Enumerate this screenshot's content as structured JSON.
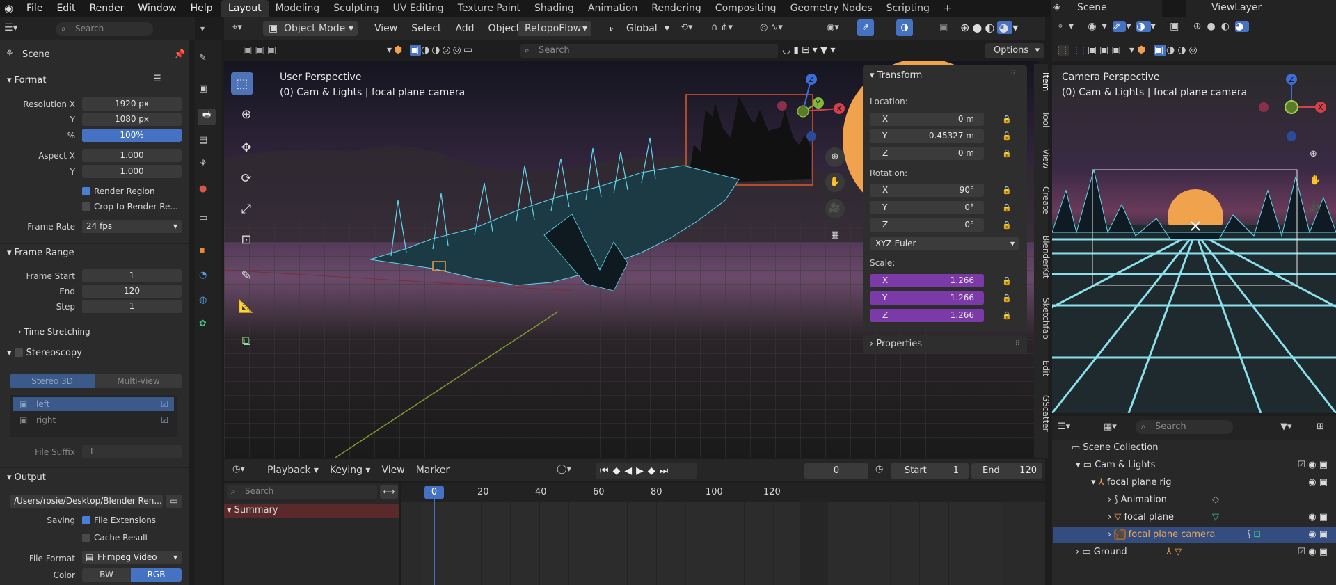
{
  "menu": {
    "items": [
      "File",
      "Edit",
      "Render",
      "Window",
      "Help"
    ]
  },
  "workspaces": {
    "tabs": [
      "Layout",
      "Modeling",
      "Sculpting",
      "UV Editing",
      "Texture Paint",
      "Shading",
      "Animation",
      "Rendering",
      "Compositing",
      "Geometry Nodes",
      "Scripting"
    ],
    "active": "Layout"
  },
  "topright": {
    "scene": "Scene",
    "viewlayer": "ViewLayer"
  },
  "properties": {
    "search_placeholder": "Search",
    "scene_label": "Scene",
    "format": {
      "title": "Format",
      "res_x_label": "Resolution X",
      "res_x": "1920 px",
      "res_y_label": "Y",
      "res_y": "1080 px",
      "pct_label": "%",
      "pct": "100%",
      "aspect_x_label": "Aspect X",
      "aspect_x": "1.000",
      "aspect_y_label": "Y",
      "aspect_y": "1.000",
      "render_region": "Render Region",
      "crop": "Crop to Render Re...",
      "frame_rate_label": "Frame Rate",
      "frame_rate": "24 fps"
    },
    "frame_range": {
      "title": "Frame Range",
      "start_label": "Frame Start",
      "start": "1",
      "end_label": "End",
      "end": "120",
      "step_label": "Step",
      "step": "1",
      "time_stretching": "Time Stretching"
    },
    "stereoscopy": {
      "title": "Stereoscopy",
      "tab_a": "Stereo 3D",
      "tab_b": "Multi-View",
      "left": "left",
      "right": "right",
      "suffix_label": "File Suffix",
      "suffix": "_L"
    },
    "output": {
      "title": "Output",
      "path": "/Users/rosie/Desktop/Blender Ren...",
      "saving_label": "Saving",
      "file_ext": "File Extensions",
      "cache": "Cache Result",
      "format_label": "File Format",
      "format": "FFmpeg Video",
      "color_label": "Color",
      "bw": "BW",
      "rgb": "RGB"
    }
  },
  "viewport": {
    "mode": "Object Mode",
    "menus": [
      "View",
      "Select",
      "Add",
      "Object"
    ],
    "retopoflow": "RetopoFlow",
    "orientation": "Global",
    "search_placeholder": "Search",
    "options": "Options",
    "perspective": "User Perspective",
    "context": "(0) Cam & Lights | focal plane camera",
    "side_tabs": [
      "Item",
      "Tool",
      "View",
      "Create",
      "BlenderKit",
      "Sketchfab",
      "Edit",
      "GScatter"
    ]
  },
  "transform": {
    "title": "Transform",
    "location_label": "Location:",
    "location": [
      {
        "axis": "X",
        "value": "0 m"
      },
      {
        "axis": "Y",
        "value": "0.45327 m"
      },
      {
        "axis": "Z",
        "value": "0 m"
      }
    ],
    "rotation_label": "Rotation:",
    "rotation": [
      {
        "axis": "X",
        "value": "90°"
      },
      {
        "axis": "Y",
        "value": "0°"
      },
      {
        "axis": "Z",
        "value": "0°"
      }
    ],
    "rotation_mode": "XYZ Euler",
    "scale_label": "Scale:",
    "scale": [
      {
        "axis": "X",
        "value": "1.266"
      },
      {
        "axis": "Y",
        "value": "1.266"
      },
      {
        "axis": "Z",
        "value": "1.266"
      }
    ],
    "properties": "Properties"
  },
  "timeline": {
    "menus": [
      "Playback",
      "Keying",
      "View",
      "Marker"
    ],
    "current": "0",
    "start_label": "Start",
    "start": "1",
    "end_label": "End",
    "end": "120",
    "search_placeholder": "Search",
    "summary": "Summary",
    "ticks": [
      "0",
      "20",
      "40",
      "60",
      "80",
      "100",
      "120"
    ]
  },
  "camera_view": {
    "perspective": "Camera Perspective",
    "context": "(0) Cam & Lights | focal plane camera"
  },
  "outliner": {
    "search_placeholder": "Search",
    "rows": [
      "Scene Collection",
      "Cam & Lights",
      "focal plane rig",
      "Animation",
      "focal plane",
      "focal plane camera",
      "Ground"
    ]
  },
  "colors": {
    "accent": "#4672c4",
    "selection": "#334d80",
    "wire": "#5fd8ef",
    "sun": "#f1a24c",
    "scale": "#7b3aa7"
  }
}
